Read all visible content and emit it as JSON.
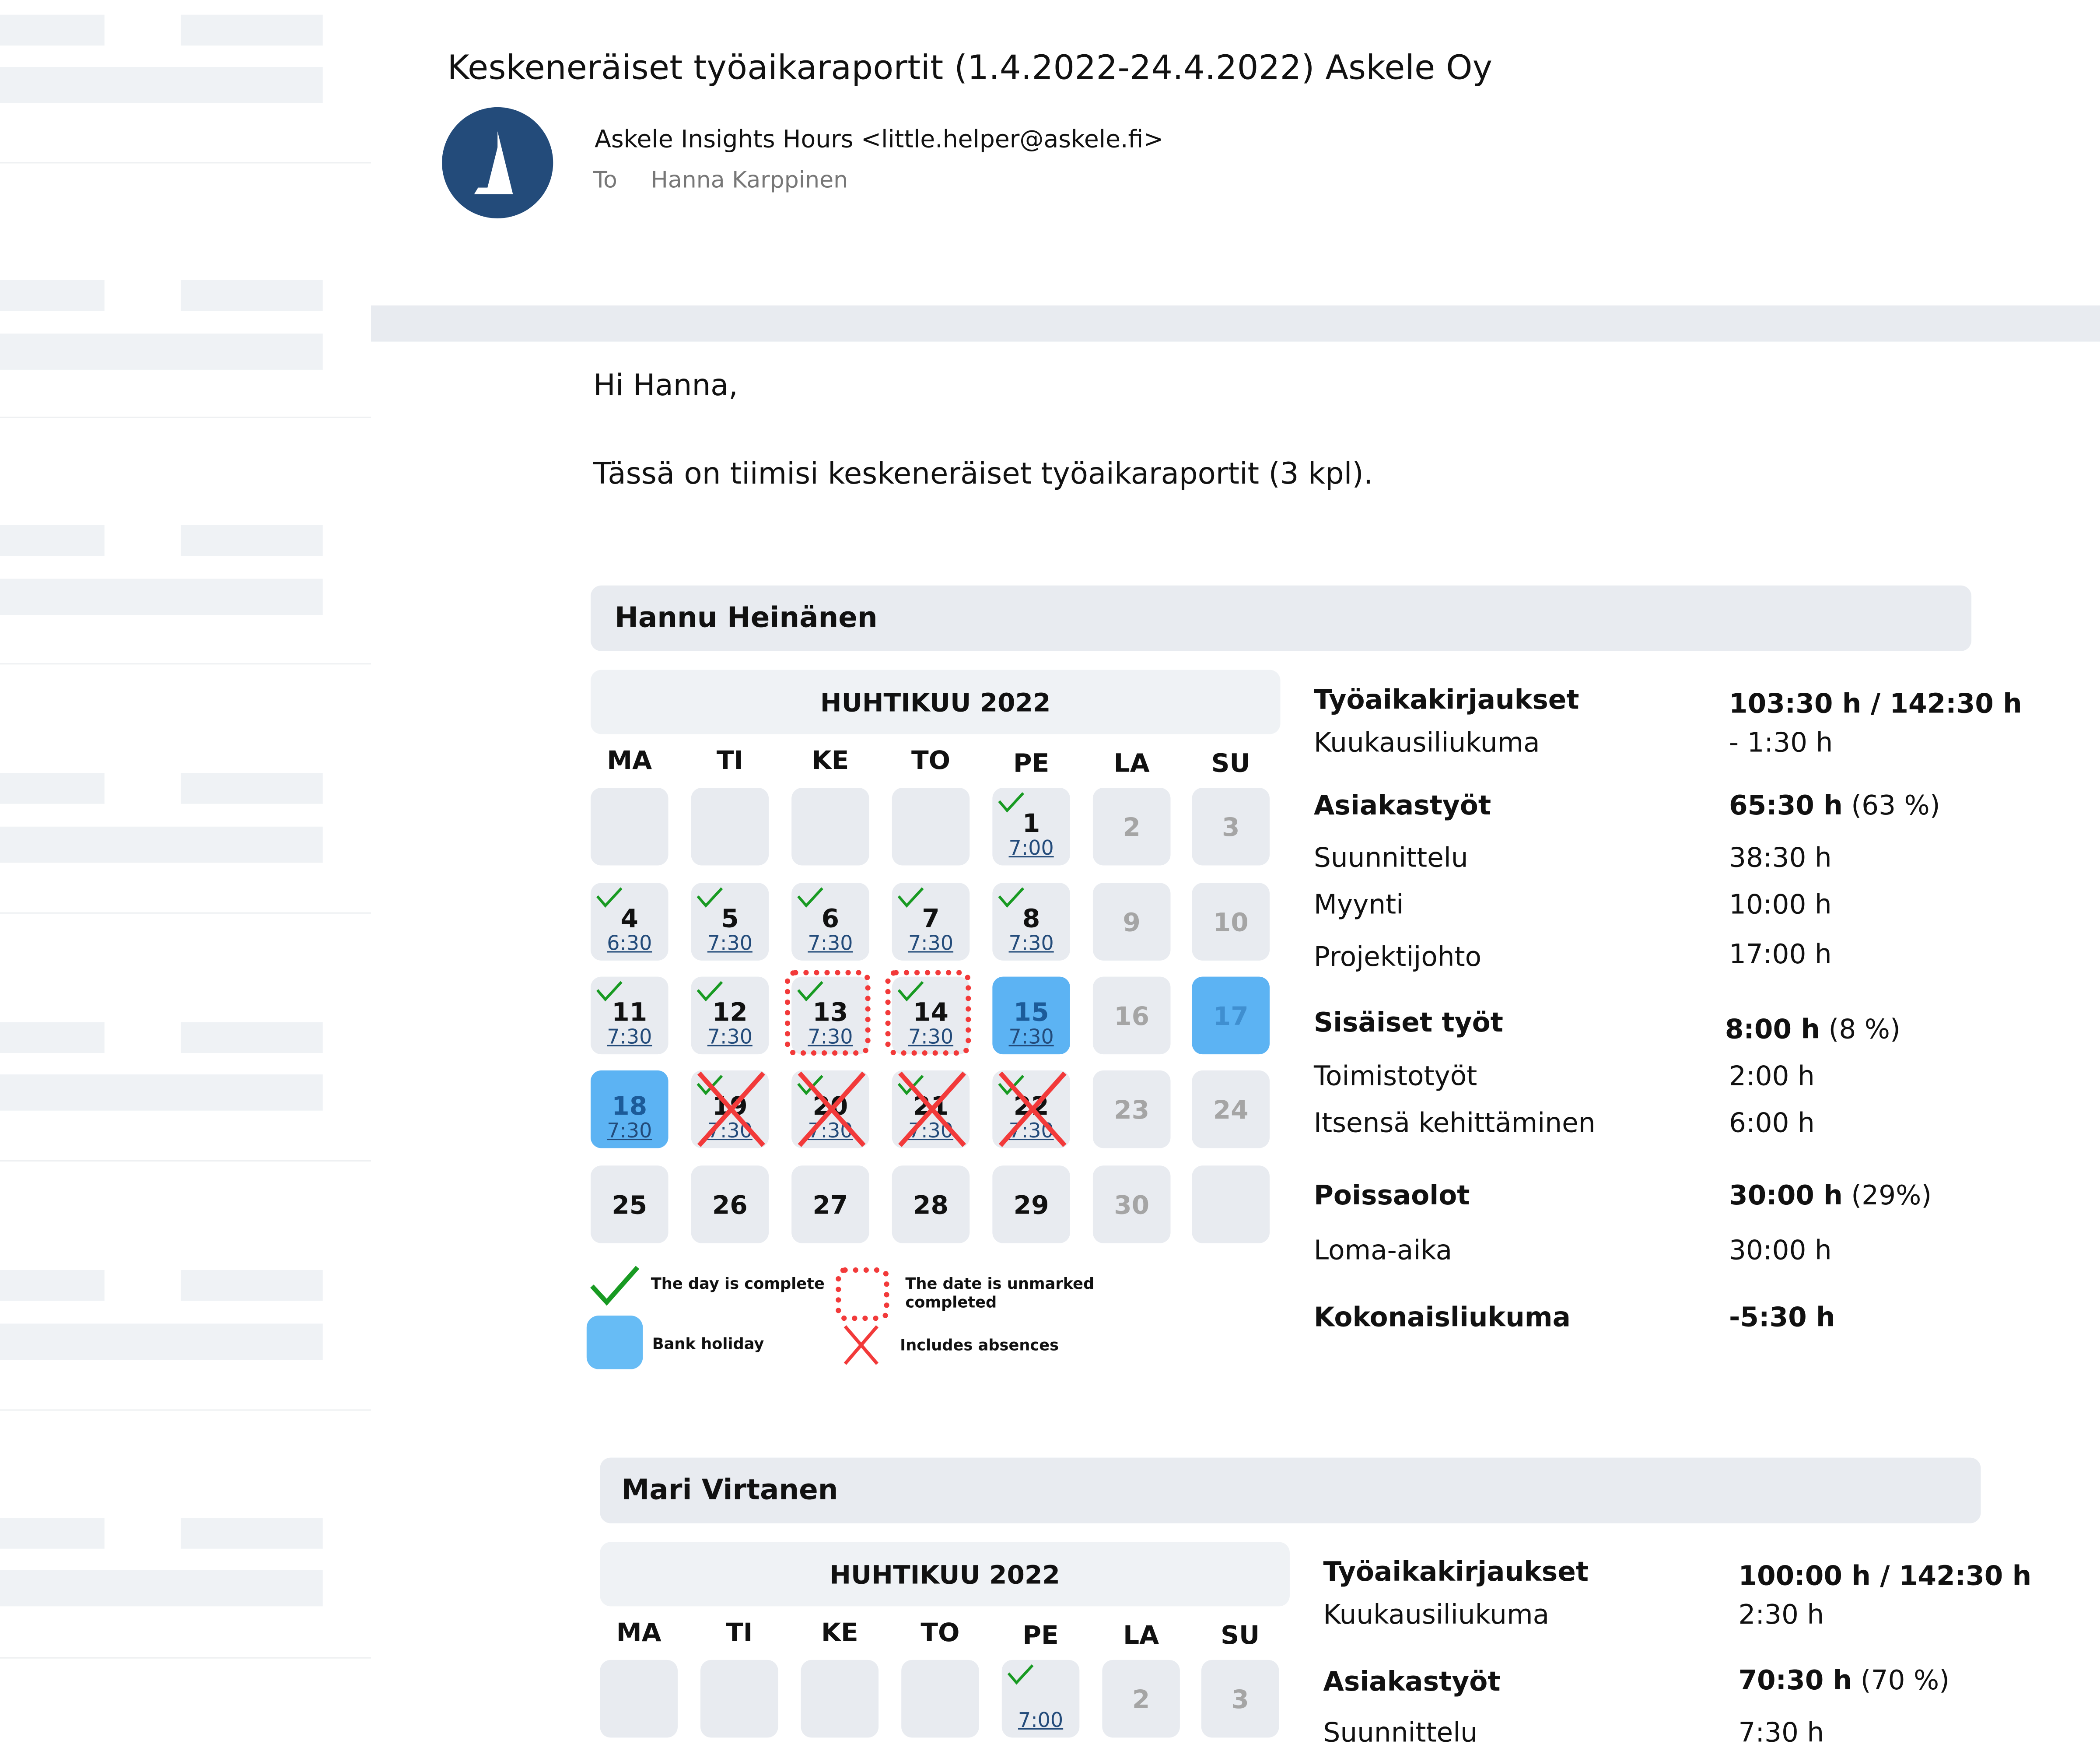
{
  "email": {
    "subject": "Keskeneräiset työaikaraportit (1.4.2022-24.4.2022) Askele  Oy",
    "sender": "Askele Insights Hours <little.helper@askele.fi>",
    "to_label": "To",
    "to_name": "Hanna Karppinen",
    "avatar_icon": "askele-logo-icon",
    "greeting": "Hi Hanna,",
    "intro": "Tässä on tiimisi keskeneräiset työaikaraportit (3 kpl)."
  },
  "colors": {
    "brand": "#234b7a",
    "holiday": "#5cb3f3",
    "complete_check": "#189a22",
    "alert_red": "#f23a3a",
    "cell_bg": "#e8ebf0"
  },
  "weekdays": [
    "MA",
    "TI",
    "KE",
    "TO",
    "PE",
    "LA",
    "SU"
  ],
  "legend": {
    "complete": "The day is complete",
    "unmarked": "The date is unmarked completed",
    "unmarked_line1": "The date is unmarked",
    "unmarked_line2": "completed",
    "holiday": "Bank holiday",
    "absences": "Includes absences"
  },
  "reports": [
    {
      "name": "Hannu Heinänen",
      "month": "HUHTIKUU 2022",
      "weeks": [
        [
          {
            "day": "",
            "hours": ""
          },
          {
            "day": "",
            "hours": ""
          },
          {
            "day": "",
            "hours": ""
          },
          {
            "day": "",
            "hours": ""
          },
          {
            "day": "1",
            "hours": "7:00",
            "complete": true
          },
          {
            "day": "2",
            "hours": "",
            "weekend": true
          },
          {
            "day": "3",
            "hours": "",
            "weekend": true
          }
        ],
        [
          {
            "day": "4",
            "hours": "6:30",
            "complete": true
          },
          {
            "day": "5",
            "hours": "7:30",
            "complete": true
          },
          {
            "day": "6",
            "hours": "7:30",
            "complete": true
          },
          {
            "day": "7",
            "hours": "7:30",
            "complete": true
          },
          {
            "day": "8",
            "hours": "7:30",
            "complete": true
          },
          {
            "day": "9",
            "hours": "",
            "weekend": true
          },
          {
            "day": "10",
            "hours": "",
            "weekend": true
          }
        ],
        [
          {
            "day": "11",
            "hours": "7:30",
            "complete": true
          },
          {
            "day": "12",
            "hours": "7:30",
            "complete": true
          },
          {
            "day": "13",
            "hours": "7:30",
            "complete": true,
            "unmarked": true
          },
          {
            "day": "14",
            "hours": "7:30",
            "complete": true,
            "unmarked": true
          },
          {
            "day": "15",
            "hours": "7:30",
            "holiday": true
          },
          {
            "day": "16",
            "hours": "",
            "weekend": true
          },
          {
            "day": "17",
            "hours": "",
            "weekend": true,
            "holiday": true
          }
        ],
        [
          {
            "day": "18",
            "hours": "7:30",
            "holiday": true
          },
          {
            "day": "19",
            "hours": "7:30",
            "complete": true,
            "absence": true
          },
          {
            "day": "20",
            "hours": "7:30",
            "complete": true,
            "absence": true
          },
          {
            "day": "21",
            "hours": "7:30",
            "complete": true,
            "absence": true
          },
          {
            "day": "22",
            "hours": "7:30",
            "complete": true,
            "absence": true
          },
          {
            "day": "23",
            "hours": "",
            "weekend": true
          },
          {
            "day": "24",
            "hours": "",
            "weekend": true
          }
        ],
        [
          {
            "day": "25",
            "hours": ""
          },
          {
            "day": "26",
            "hours": ""
          },
          {
            "day": "27",
            "hours": ""
          },
          {
            "day": "28",
            "hours": ""
          },
          {
            "day": "29",
            "hours": ""
          },
          {
            "day": "30",
            "hours": "",
            "weekend": true
          },
          {
            "day": "",
            "hours": ""
          }
        ]
      ],
      "stats": {
        "tyoaika_label": "Työaikakirjaukset",
        "tyoaika_value": "103:30 h / 142:30 h",
        "kuukausi_label": "Kuukausiliukuma",
        "kuukausi_value": "- 1:30 h",
        "asiakas_label": "Asiakastyöt",
        "asiakas_value": "65:30 h",
        "asiakas_pct": "(63 %)",
        "asiakas_items": [
          {
            "label": "Suunnittelu",
            "value": "38:30 h"
          },
          {
            "label": "Myynti",
            "value": "10:00 h"
          },
          {
            "label": "Projektijohto",
            "value": "17:00 h"
          }
        ],
        "sisaiset_label": "Sisäiset työt",
        "sisaiset_value": "8:00 h",
        "sisaiset_pct": "(8 %)",
        "sisaiset_items": [
          {
            "label": "Toimistotyöt",
            "value": "2:00 h"
          },
          {
            "label": "Itsensä kehittäminen",
            "value": "6:00 h"
          }
        ],
        "poissa_label": "Poissaolot",
        "poissa_value": "30:00 h",
        "poissa_pct": "(29%)",
        "poissa_items": [
          {
            "label": "Loma-aika",
            "value": "30:00 h"
          }
        ],
        "kokonais_label": "Kokonaisliukuma",
        "kokonais_value": "-5:30 h"
      }
    },
    {
      "name": "Mari Virtanen",
      "month": "HUHTIKUU 2022",
      "weeks": [
        [
          {
            "day": "",
            "hours": ""
          },
          {
            "day": "",
            "hours": ""
          },
          {
            "day": "",
            "hours": ""
          },
          {
            "day": "",
            "hours": ""
          },
          {
            "day": "",
            "hours": "7:00",
            "complete": true
          },
          {
            "day": "2",
            "hours": "",
            "weekend": true
          },
          {
            "day": "3",
            "hours": "",
            "weekend": true
          }
        ]
      ],
      "stats": {
        "tyoaika_label": "Työaikakirjaukset",
        "tyoaika_value": "100:00 h / 142:30 h",
        "kuukausi_label": "Kuukausiliukuma",
        "kuukausi_value": "2:30 h",
        "asiakas_label": "Asiakastyöt",
        "asiakas_value": "70:30 h",
        "asiakas_pct": "(70 %)",
        "asiakas_items": [
          {
            "label": "Suunnittelu",
            "value": "7:30 h"
          }
        ]
      }
    }
  ]
}
